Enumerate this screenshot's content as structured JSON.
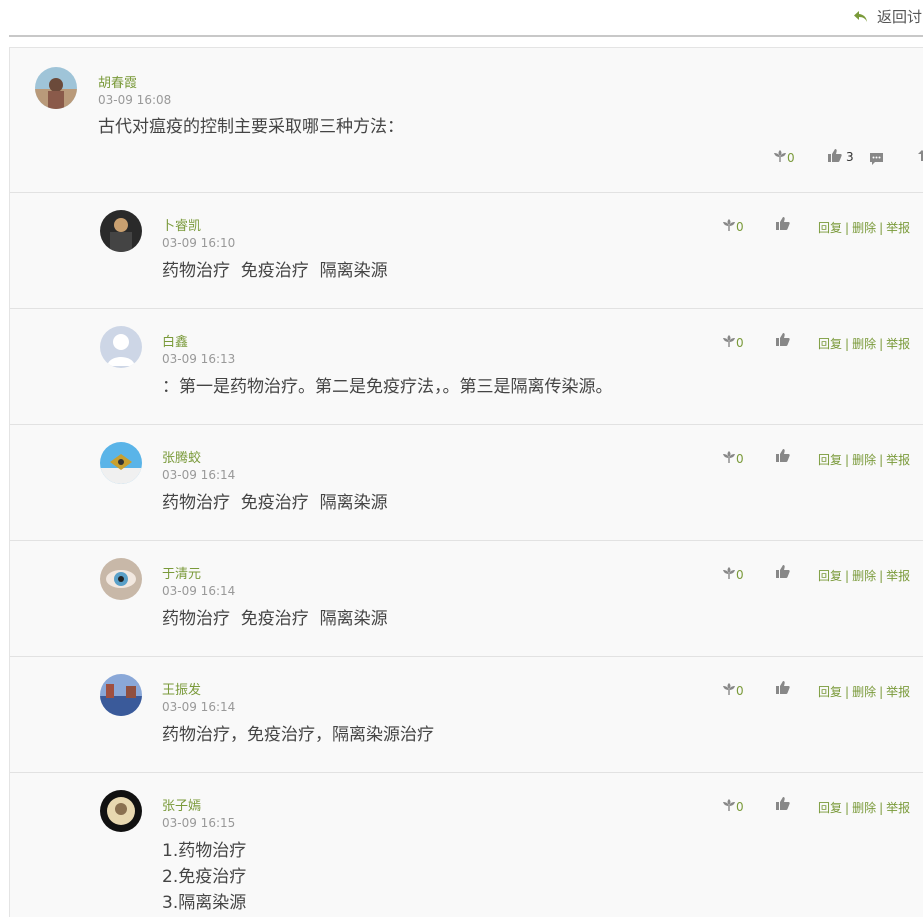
{
  "header": {
    "back_label": "返回讨"
  },
  "post": {
    "author": "胡春霞",
    "time": "03-09 16:08",
    "content": "古代对瘟疫的控制主要采取哪三种方法：",
    "flower_count": "0",
    "like_count": "3"
  },
  "reply_actions": {
    "reply": "回复",
    "delete": "删除",
    "report": "举报"
  },
  "replies": [
    {
      "author": "卜睿凯",
      "time": "03-09 16:10",
      "lines": [
        "药物治疗  免疫治疗  隔离染源"
      ],
      "flower_count": "0"
    },
    {
      "author": "白鑫",
      "time": "03-09 16:13",
      "lines": [
        "：第一是药物治疗。第二是免疫疗法，。第三是隔离传染源。"
      ],
      "flower_count": "0"
    },
    {
      "author": "张腾蛟",
      "time": "03-09 16:14",
      "lines": [
        "药物治疗  免疫治疗  隔离染源"
      ],
      "flower_count": "0"
    },
    {
      "author": "于清元",
      "time": "03-09 16:14",
      "lines": [
        "药物治疗  免疫治疗  隔离染源"
      ],
      "flower_count": "0"
    },
    {
      "author": "王振发",
      "time": "03-09 16:14",
      "lines": [
        "药物治疗，免疫治疗，隔离染源治疗"
      ],
      "flower_count": "0"
    },
    {
      "author": "张子嫣",
      "time": "03-09 16:15",
      "lines": [
        "1.药物治疗",
        "2.免疫治疗",
        "3.隔离染源"
      ],
      "flower_count": "0"
    }
  ]
}
